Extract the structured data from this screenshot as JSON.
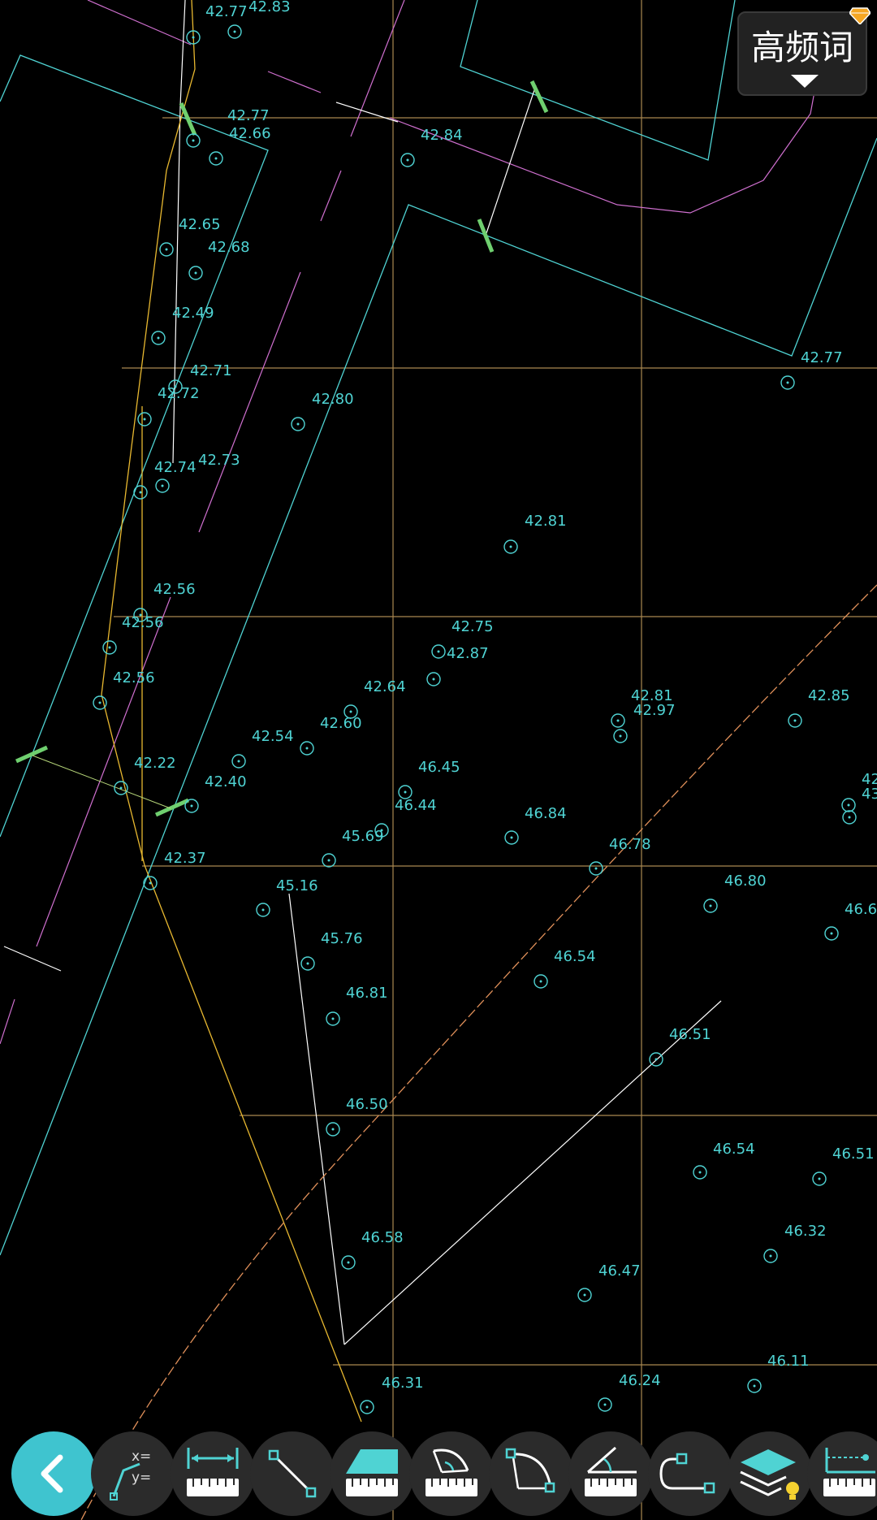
{
  "header": {
    "keyword_button_label": "高频词"
  },
  "colors": {
    "background": "#000000",
    "grid": "#c8a060",
    "cyan_lines": "#4fd3d3",
    "labels": "#4fd3d3",
    "magenta": "#d070d0",
    "yellow": "#e8b830",
    "green_marks": "#6fcf6f",
    "accent_back": "#3fc4cf",
    "tool_bg": "#2b2b2b"
  },
  "elevations": [
    "42.77",
    "42.83",
    "42.77",
    "42.66",
    "42.84",
    "42.65",
    "42.68",
    "42.49",
    "42.71",
    "42.72",
    "42.80",
    "42.77",
    "42.73",
    "42.74",
    "42.81",
    "42.56",
    "42.56",
    "42.75",
    "42.87",
    "42.56",
    "42.64",
    "42.81",
    "42.97",
    "42.85",
    "42.60",
    "42.54",
    "42.22",
    "46.45",
    "42.40",
    "46.44",
    "46.84",
    "45.69",
    "46.78",
    "42.37",
    "45.16",
    "46.80",
    "46.6",
    "45.76",
    "46.54",
    "46.81",
    "46.51",
    "46.50",
    "46.54",
    "46.51",
    "46.58",
    "46.32",
    "46.47",
    "46.11",
    "46.31",
    "46.24",
    "42",
    "43"
  ],
  "toolbar": {
    "xy_label_x": "x=",
    "xy_label_y": "y=",
    "items": [
      {
        "name": "back",
        "icon": "chevron-left-icon"
      },
      {
        "name": "coordinate",
        "icon": "coordinate-icon"
      },
      {
        "name": "distance",
        "icon": "distance-ruler-icon"
      },
      {
        "name": "line",
        "icon": "line-segment-icon"
      },
      {
        "name": "area",
        "icon": "area-ruler-icon"
      },
      {
        "name": "angle-arc",
        "icon": "arc-angle-icon"
      },
      {
        "name": "arc",
        "icon": "arc-icon"
      },
      {
        "name": "angle",
        "icon": "angle-ruler-icon"
      },
      {
        "name": "path",
        "icon": "path-icon"
      },
      {
        "name": "layers",
        "icon": "layers-icon"
      },
      {
        "name": "axis-measure",
        "icon": "axis-ruler-icon"
      }
    ]
  }
}
